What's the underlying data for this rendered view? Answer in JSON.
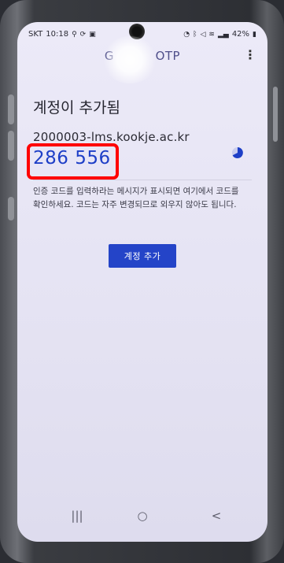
{
  "status_bar": {
    "carrier": "SKT",
    "time": "10:18",
    "left_icons": [
      "location-icon",
      "sync-icon",
      "gallery-icon"
    ],
    "battery": "42%",
    "right_icons": [
      "alarm-icon",
      "bluetooth-icon",
      "mute-icon",
      "wifi-icon",
      "signal-icon",
      "battery-icon"
    ]
  },
  "app_bar": {
    "title_left": "G",
    "title_right": "OTP",
    "menu_icon": "more-vert-icon"
  },
  "main": {
    "heading": "계정이 추가됨",
    "account": "2000003-lms.kookje.ac.kr",
    "code": "286 556",
    "timer_icon": "countdown-icon",
    "description": "인증 코드를 입력하라는 메시지가 표시되면 여기에서 코드를 확인하세요. 코드는 자주 변경되므로 외우지 않아도 됩니다.",
    "add_account_label": "계정 추가"
  },
  "navbar": {
    "recent": "|||",
    "home": "○",
    "back": "<"
  },
  "colors": {
    "accent": "#2444c8",
    "code_text": "#1e3fc7",
    "highlight_border": "#ff0000",
    "screen_bg": "#e9e7f5"
  }
}
